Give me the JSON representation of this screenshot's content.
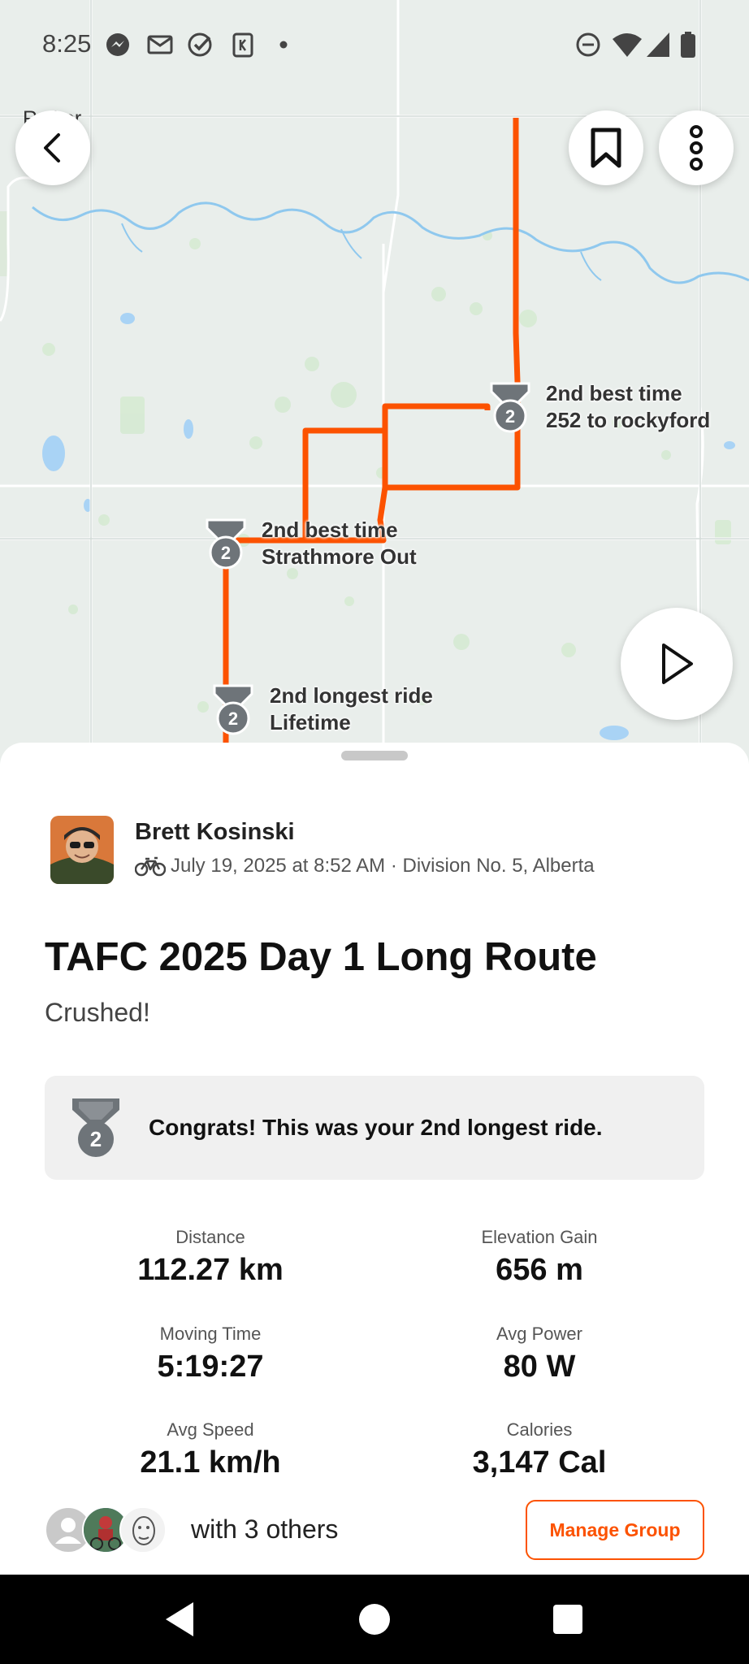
{
  "status_bar": {
    "time": "8:25",
    "left_icons": [
      "messenger-icon",
      "mail-icon",
      "tasks-icon",
      "app-icon",
      "dot-icon"
    ],
    "right_icons": [
      "do-not-disturb-icon",
      "wifi-icon",
      "signal-icon",
      "battery-icon"
    ]
  },
  "map": {
    "partial_place_label": "R   cker",
    "route_color": "#fc5200",
    "annotations": [
      {
        "line1": "2nd best time",
        "line2": "252 to rockyford",
        "badge": "2"
      },
      {
        "line1": "2nd best time",
        "line2": "Strathmore Out",
        "badge": "2"
      },
      {
        "line1": "2nd longest ride",
        "line2": "Lifetime",
        "badge": "2"
      }
    ]
  },
  "activity": {
    "athlete_name": "Brett Kosinski",
    "meta": "July 19, 2025 at 8:52 AM · Division No. 5, Alberta",
    "title": "TAFC 2025 Day 1 Long Route",
    "description": "Crushed!",
    "congrats_badge": "2",
    "congrats": "Congrats! This was your 2nd longest ride."
  },
  "stats": [
    {
      "label": "Distance",
      "value": "112.27 km"
    },
    {
      "label": "Elevation Gain",
      "value": "656 m"
    },
    {
      "label": "Moving Time",
      "value": "5:19:27"
    },
    {
      "label": "Avg Power",
      "value": "80 W"
    },
    {
      "label": "Avg Speed",
      "value": "21.1 km/h"
    },
    {
      "label": "Calories",
      "value": "3,147 Cal"
    }
  ],
  "group": {
    "text": "with 3 others",
    "manage_label": "Manage Group"
  },
  "colors": {
    "accent": "#fc5200",
    "map_bg": "#e9eeeb",
    "river": "#8fc8ee",
    "badge": "#6e7479"
  }
}
